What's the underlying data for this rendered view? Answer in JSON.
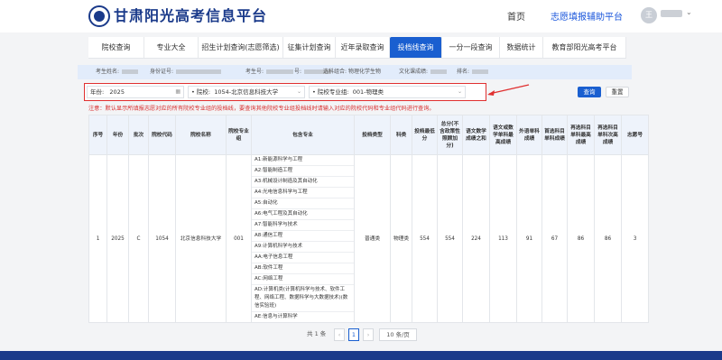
{
  "header": {
    "brand": "甘肃阳光高考信息平台",
    "nav": {
      "home": "首页",
      "assist": "志愿填报辅助平台"
    },
    "avatar_initial": "王",
    "icons": {
      "logo": "emblem-icon",
      "caret": "chevron-down-icon"
    }
  },
  "tabs": [
    "院校查询",
    "专业大全",
    "招生计划查询(志愿筛选)",
    "征集计划查询",
    "近年录取查询",
    "投档线查询",
    "一分一段查询",
    "数据统计",
    "教育部阳光高考平台"
  ],
  "active_tab": "投档线查询",
  "info": {
    "name_label": "考生姓名:",
    "id_label": "身份证号:",
    "exam_label": "考生号:",
    "number_label": "号:",
    "subjects_label": "选科组合:",
    "subjects_value": "物理化学生物",
    "score_label": "文化课成绩:",
    "rank_label": "排名:"
  },
  "filters": {
    "year_label": "年份:",
    "year_value": "2025",
    "school_label": "• 院校:",
    "school_value": "1054-北京信息科技大学",
    "group_label": "• 院校专业组:",
    "group_value": "001-物理类"
  },
  "buttons": {
    "search": "查询",
    "reset": "重置"
  },
  "notice": "注意：默认显示所填报志愿对应的所有院校专业组的投档线，要查询其他院校专业组投档线时请输入对应的院校代码和专业组代码进行查询。",
  "table": {
    "headers": [
      "序号",
      "年份",
      "批次",
      "院校代码",
      "院校名称",
      "院校专业组",
      "包含专业",
      "投档类型",
      "科类",
      "投档最低分",
      "总分(不含政策性照顾加分)",
      "语文数学成绩之和",
      "语文或数学单科最高成绩",
      "外语单科成绩",
      "首选科目单科成绩",
      "再选科目单科最高成绩",
      "再选科目单科次高成绩",
      "志愿号"
    ],
    "row": {
      "seq": "1",
      "year": "2025",
      "batch": "C",
      "code": "1054",
      "school": "北京信息科技大学",
      "group": "001",
      "majors": [
        "A1:新能源科学与工程",
        "A2:智能制造工程",
        "A3:机械设计制造及其自动化",
        "A4:光电信息科学与工程",
        "A5:自动化",
        "A6:电气工程及其自动化",
        "A7:智能科学与技术",
        "A8:通信工程",
        "A9:计算机科学与技术",
        "AA:电子信息工程",
        "AB:软件工程",
        "AC:网络工程",
        "AD:计算机类(计算机科学与技术、软件工程、网络工程、数据科学与大数据技术)(数信实验班)",
        "AE:信息与计算科学"
      ],
      "type": "普通类",
      "subject": "物理类",
      "min_score": "554",
      "total": "554",
      "chn_math": "224",
      "chn_or_math_max": "113",
      "foreign": "91",
      "primary": "67",
      "second_max": "86",
      "second_next": "86",
      "wish_no": "3"
    }
  },
  "pager": {
    "total": "共 1 条",
    "prev": "‹",
    "current": "1",
    "next": "›",
    "page_size": "10 条/页"
  },
  "colors": {
    "primary": "#1a5fd0",
    "brand": "#1a3a8a",
    "alert": "#d93030",
    "annotation": "#e03030"
  }
}
